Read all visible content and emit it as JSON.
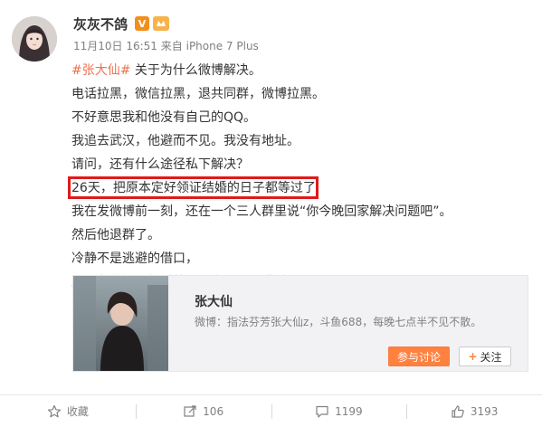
{
  "user": {
    "name": "灰灰不鸽",
    "verified_badge": "V",
    "timestamp": "11月10日 16:51",
    "source_prefix": "来自",
    "source": "iPhone 7 Plus"
  },
  "post": {
    "topic": "#张大仙#",
    "lines": [
      " 关于为什么微博解决。",
      "电话拉黑，微信拉黑，退共同群，微博拉黑。",
      "不好意思我和他没有自己的QQ。",
      "我追去武汉，他避而不见。我没有地址。",
      "请问，还有什么途径私下解决？",
      "26天，把原本定好领证结婚的日子都等过了",
      "我在发微博前一刻，还在一个三人群里说“你今晚回家解决问题吧”。",
      "然后他退群了。",
      "冷静不是逃避的借口，",
      "上一条微博，暂时就四个字，不要逃避。"
    ]
  },
  "card": {
    "title": "张大仙",
    "description": "微博：指法芬芳张大仙z，斗鱼688，每晚七点半不见不散。",
    "discuss_label": "参与讨论",
    "follow_plus": "+",
    "follow_label": "关注"
  },
  "actions": {
    "favorite_label": "收藏",
    "repost_count": "106",
    "comment_count": "1199",
    "like_count": "3193"
  },
  "colors": {
    "accent": "#eb7350",
    "highlight_border": "#e01a1a",
    "discuss_button": "#ff8140"
  }
}
